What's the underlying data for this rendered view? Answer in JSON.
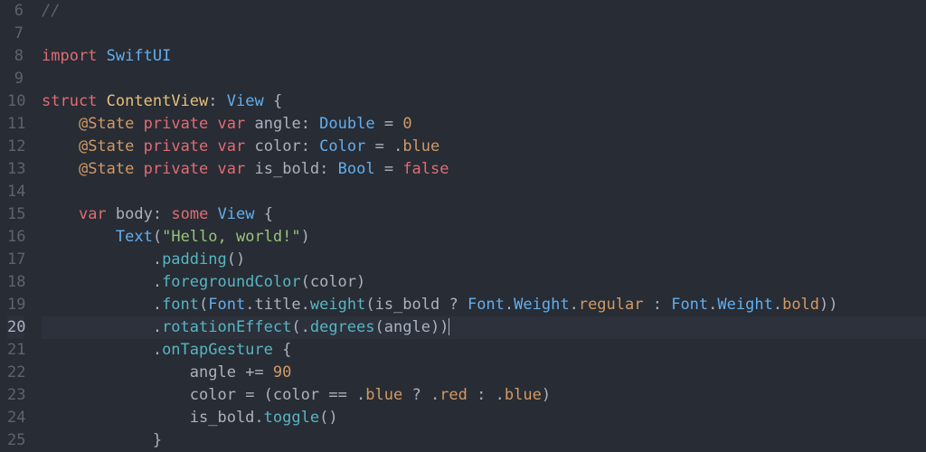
{
  "editor": {
    "language": "swift",
    "current_line": 20,
    "first_line": 6,
    "lines": [
      {
        "n": 6,
        "tokens": [
          [
            "cm",
            "//"
          ]
        ]
      },
      {
        "n": 7,
        "tokens": []
      },
      {
        "n": 8,
        "tokens": [
          [
            "kw2",
            "import"
          ],
          [
            "sp",
            " "
          ],
          [
            "ty",
            "SwiftUI"
          ]
        ]
      },
      {
        "n": 9,
        "tokens": []
      },
      {
        "n": 10,
        "tokens": [
          [
            "kw2",
            "struct"
          ],
          [
            "sp",
            " "
          ],
          [
            "id",
            "ContentView"
          ],
          [
            "punc",
            ": "
          ],
          [
            "ty",
            "View"
          ],
          [
            "punc",
            " {"
          ]
        ]
      },
      {
        "n": 11,
        "tokens": [
          [
            "sp",
            "    "
          ],
          [
            "at",
            "@State"
          ],
          [
            "sp",
            " "
          ],
          [
            "kw2",
            "private"
          ],
          [
            "sp",
            " "
          ],
          [
            "kw2",
            "var"
          ],
          [
            "sp",
            " "
          ],
          [
            "var",
            "angle"
          ],
          [
            "punc",
            ": "
          ],
          [
            "ty",
            "Double"
          ],
          [
            "punc",
            " = "
          ],
          [
            "num",
            "0"
          ]
        ]
      },
      {
        "n": 12,
        "tokens": [
          [
            "sp",
            "    "
          ],
          [
            "at",
            "@State"
          ],
          [
            "sp",
            " "
          ],
          [
            "kw2",
            "private"
          ],
          [
            "sp",
            " "
          ],
          [
            "kw2",
            "var"
          ],
          [
            "sp",
            " "
          ],
          [
            "var",
            "color"
          ],
          [
            "punc",
            ": "
          ],
          [
            "ty",
            "Color"
          ],
          [
            "punc",
            " = ."
          ],
          [
            "enum",
            "blue"
          ]
        ]
      },
      {
        "n": 13,
        "tokens": [
          [
            "sp",
            "    "
          ],
          [
            "at",
            "@State"
          ],
          [
            "sp",
            " "
          ],
          [
            "kw2",
            "private"
          ],
          [
            "sp",
            " "
          ],
          [
            "kw2",
            "var"
          ],
          [
            "sp",
            " "
          ],
          [
            "var",
            "is_bold"
          ],
          [
            "punc",
            ": "
          ],
          [
            "ty",
            "Bool"
          ],
          [
            "punc",
            " = "
          ],
          [
            "bool",
            "false"
          ]
        ]
      },
      {
        "n": 14,
        "tokens": []
      },
      {
        "n": 15,
        "tokens": [
          [
            "sp",
            "    "
          ],
          [
            "kw2",
            "var"
          ],
          [
            "sp",
            " "
          ],
          [
            "var",
            "body"
          ],
          [
            "punc",
            ": "
          ],
          [
            "kw2",
            "some"
          ],
          [
            "sp",
            " "
          ],
          [
            "ty",
            "View"
          ],
          [
            "punc",
            " {"
          ]
        ]
      },
      {
        "n": 16,
        "tokens": [
          [
            "sp",
            "        "
          ],
          [
            "ty",
            "Text"
          ],
          [
            "punc",
            "("
          ],
          [
            "str",
            "\"Hello, world!\""
          ],
          [
            "punc",
            ")"
          ]
        ]
      },
      {
        "n": 17,
        "tokens": [
          [
            "sp",
            "            ."
          ],
          [
            "fn",
            "padding"
          ],
          [
            "punc",
            "()"
          ]
        ]
      },
      {
        "n": 18,
        "tokens": [
          [
            "sp",
            "            ."
          ],
          [
            "fn",
            "foregroundColor"
          ],
          [
            "punc",
            "("
          ],
          [
            "var",
            "color"
          ],
          [
            "punc",
            ")"
          ]
        ]
      },
      {
        "n": 19,
        "tokens": [
          [
            "sp",
            "            ."
          ],
          [
            "fn",
            "font"
          ],
          [
            "punc",
            "("
          ],
          [
            "ty",
            "Font"
          ],
          [
            "punc",
            "."
          ],
          [
            "var",
            "title"
          ],
          [
            "punc",
            "."
          ],
          [
            "fn",
            "weight"
          ],
          [
            "punc",
            "("
          ],
          [
            "var",
            "is_bold"
          ],
          [
            "punc",
            " ? "
          ],
          [
            "ty",
            "Font"
          ],
          [
            "punc",
            "."
          ],
          [
            "ty",
            "Weight"
          ],
          [
            "punc",
            "."
          ],
          [
            "enum",
            "regular"
          ],
          [
            "punc",
            " : "
          ],
          [
            "ty",
            "Font"
          ],
          [
            "punc",
            "."
          ],
          [
            "ty",
            "Weight"
          ],
          [
            "punc",
            "."
          ],
          [
            "enum",
            "bold"
          ],
          [
            "punc",
            "))"
          ]
        ]
      },
      {
        "n": 20,
        "tokens": [
          [
            "sp",
            "            ."
          ],
          [
            "fn",
            "rotationEffect"
          ],
          [
            "punc",
            "(."
          ],
          [
            "fn",
            "degrees"
          ],
          [
            "punc",
            "("
          ],
          [
            "var",
            "angle"
          ],
          [
            "punc",
            "))"
          ],
          [
            "cursor",
            ""
          ]
        ]
      },
      {
        "n": 21,
        "tokens": [
          [
            "sp",
            "            ."
          ],
          [
            "fn",
            "onTapGesture"
          ],
          [
            "punc",
            " {"
          ]
        ]
      },
      {
        "n": 22,
        "tokens": [
          [
            "sp",
            "                "
          ],
          [
            "var",
            "angle"
          ],
          [
            "punc",
            " += "
          ],
          [
            "num",
            "90"
          ]
        ]
      },
      {
        "n": 23,
        "tokens": [
          [
            "sp",
            "                "
          ],
          [
            "var",
            "color"
          ],
          [
            "punc",
            " = ("
          ],
          [
            "var",
            "color"
          ],
          [
            "punc",
            " == ."
          ],
          [
            "enum",
            "blue"
          ],
          [
            "punc",
            " ? ."
          ],
          [
            "enum",
            "red"
          ],
          [
            "punc",
            " : ."
          ],
          [
            "enum",
            "blue"
          ],
          [
            "punc",
            ")"
          ]
        ]
      },
      {
        "n": 24,
        "tokens": [
          [
            "sp",
            "                "
          ],
          [
            "var",
            "is_bold"
          ],
          [
            "punc",
            "."
          ],
          [
            "fn",
            "toggle"
          ],
          [
            "punc",
            "()"
          ]
        ]
      },
      {
        "n": 25,
        "tokens": [
          [
            "sp",
            "            "
          ],
          [
            "punc",
            "}"
          ]
        ]
      }
    ]
  }
}
